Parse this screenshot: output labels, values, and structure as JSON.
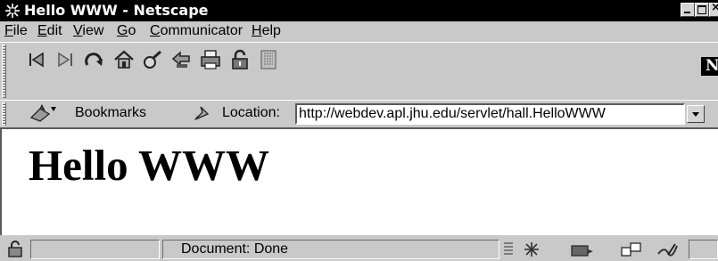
{
  "window": {
    "title": "Hello WWW - Netscape",
    "close_glyph": "×"
  },
  "menu": [
    {
      "first": "F",
      "rest": "ile"
    },
    {
      "first": "E",
      "rest": "dit"
    },
    {
      "first": "V",
      "rest": "iew"
    },
    {
      "first": "G",
      "rest": "o"
    },
    {
      "first": "C",
      "rest": "ommunicator"
    },
    {
      "first": "H",
      "rest": "elp"
    }
  ],
  "toolbar": {
    "icons": [
      "back-icon",
      "forward-icon",
      "reload-icon",
      "home-icon",
      "search-icon",
      "guide-icon",
      "print-icon",
      "security-icon",
      "stop-icon"
    ],
    "logo_letter": "N"
  },
  "location": {
    "bookmarks_label": "Bookmarks",
    "location_label": "Location:",
    "url": "http://webdev.apl.jhu.edu/servlet/hall.HelloWWW"
  },
  "page": {
    "heading": "Hello WWW"
  },
  "status": {
    "text": "Document: Done"
  }
}
